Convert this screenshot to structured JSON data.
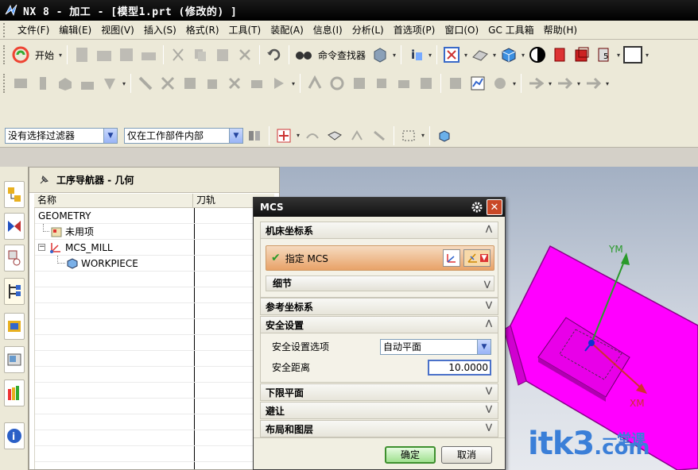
{
  "window": {
    "title": "NX 8 - 加工 - [模型1.prt  (修改的) ]"
  },
  "menu": [
    "文件(F)",
    "编辑(E)",
    "视图(V)",
    "插入(S)",
    "格式(R)",
    "工具(T)",
    "装配(A)",
    "信息(I)",
    "分析(L)",
    "首选项(P)",
    "窗口(O)",
    "GC 工具箱",
    "帮助(H)"
  ],
  "toolbar": {
    "start_label": "开始",
    "command_finder_label": "命令查找器"
  },
  "selection_bar": {
    "filter_value": "没有选择过滤器",
    "scope_value": "仅在工作部件内部"
  },
  "navigator": {
    "title": "工序导航器 - 几何",
    "columns": [
      "名称",
      "刀轨"
    ],
    "rows": [
      "GEOMETRY",
      "未用项",
      "MCS_MILL",
      "WORKPIECE"
    ]
  },
  "dialog": {
    "title": "MCS",
    "sections": {
      "machine_csys": "机床坐标系",
      "specify_mcs": "指定 MCS",
      "details": "细节",
      "ref_csys": "参考坐标系",
      "safety": "安全设置",
      "safety_option_label": "安全设置选项",
      "safety_option_value": "自动平面",
      "safety_distance_label": "安全距离",
      "safety_distance_value": "10.0000",
      "lower_plane": "下限平面",
      "avoid": "避让",
      "layout_layers": "布局和图层"
    },
    "ok_label": "确定",
    "cancel_label": "取消"
  },
  "viewport": {
    "axis_y": "YM",
    "axis_x": "XM",
    "part_color": "#ff00ff"
  },
  "watermark": {
    "brand": "itk3",
    "suffix": ".com",
    "cn": "一堂课"
  }
}
